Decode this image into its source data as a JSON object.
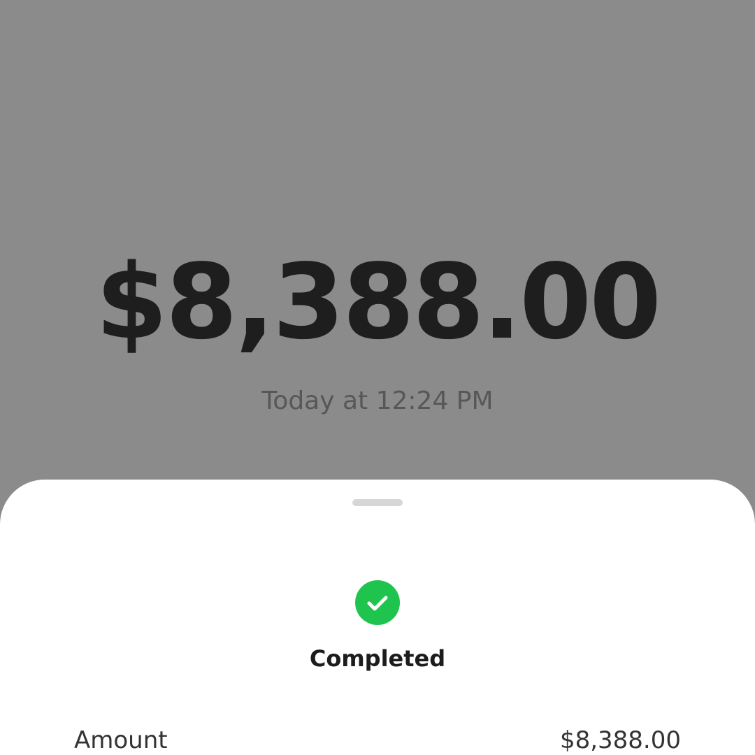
{
  "transaction": {
    "amount": "$8,388.00",
    "timestamp": "Today at 12:24 PM"
  },
  "status": {
    "label": "Completed",
    "icon": "check-circle-icon",
    "color": "#1fc44e"
  },
  "details": {
    "amount_label": "Amount",
    "amount_value": "$8,388.00"
  },
  "colors": {
    "background": "#8b8b8b",
    "sheet": "#ffffff",
    "success": "#1fc44e"
  }
}
